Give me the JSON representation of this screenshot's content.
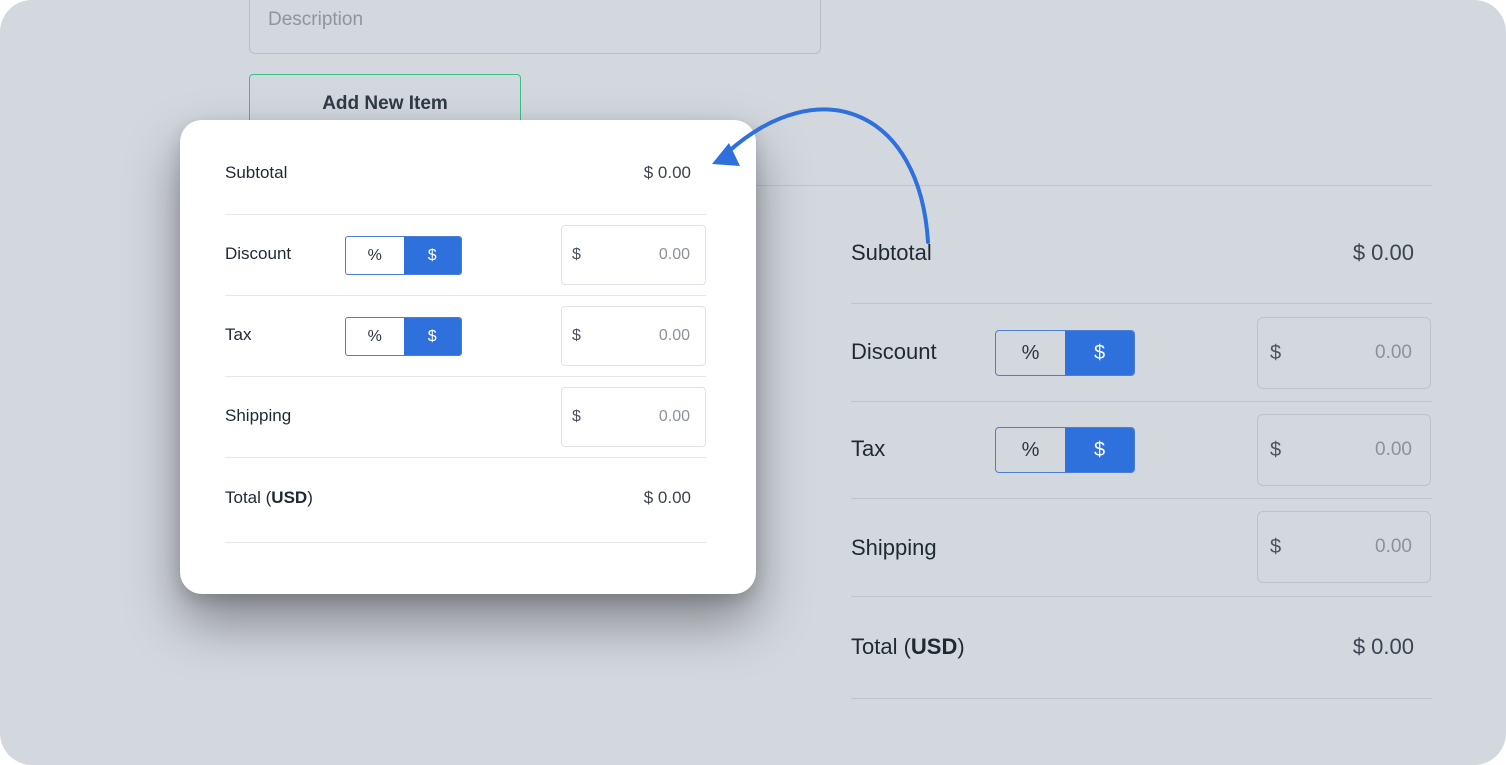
{
  "form": {
    "description_placeholder": "Description",
    "add_item_label": "Add New Item"
  },
  "summary": {
    "subtotal_label": "Subtotal",
    "subtotal_value": "$ 0.00",
    "discount_label": "Discount",
    "tax_label": "Tax",
    "shipping_label": "Shipping",
    "total_label_prefix": "Total (",
    "total_currency": "USD",
    "total_label_suffix": ")",
    "total_value": "$ 0.00",
    "toggle_percent": "%",
    "toggle_dollar": "$",
    "currency_symbol": "$",
    "discount_value": "0.00",
    "tax_value": "0.00",
    "shipping_value": "0.00"
  },
  "colors": {
    "accent_blue": "#2e70dc",
    "button_border_green": "#3fbf86",
    "background": "#d3d8df"
  }
}
